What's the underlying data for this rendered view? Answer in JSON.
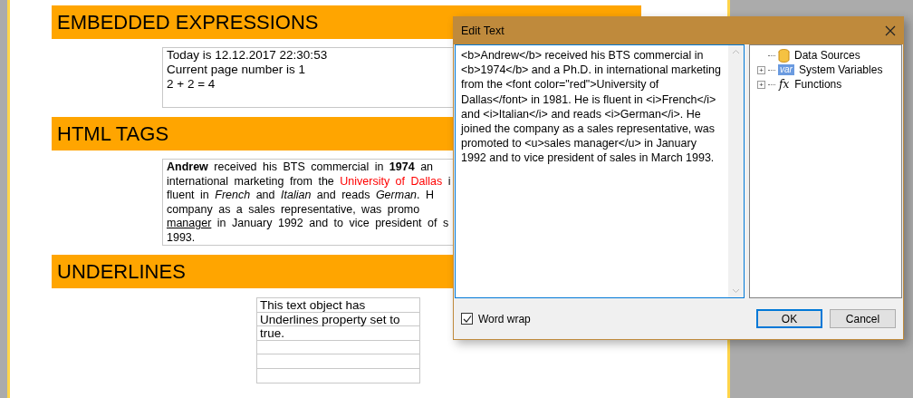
{
  "report": {
    "sections": [
      {
        "kind": "expressions",
        "title": "EMBEDDED EXPRESSIONS",
        "lines": [
          "Today is 12.12.2017 22:30:53",
          "Current page number is 1",
          "2 + 2 = 4"
        ]
      },
      {
        "kind": "html",
        "title": "HTML TAGS",
        "lines": [
          [
            {
              "text": "Andrew",
              "kind": "bold"
            },
            {
              "text": " received his BTS commercial in ",
              "kind": "plain"
            },
            {
              "text": "1974",
              "kind": "bold"
            },
            {
              "text": " an",
              "kind": "plain"
            }
          ],
          [
            {
              "text": "international marketing from the ",
              "kind": "plain"
            },
            {
              "text": "University of Dallas",
              "kind": "red"
            },
            {
              "text": " i",
              "kind": "plain"
            }
          ],
          [
            {
              "text": "fluent in ",
              "kind": "plain"
            },
            {
              "text": "French",
              "kind": "italic"
            },
            {
              "text": " and ",
              "kind": "plain"
            },
            {
              "text": "Italian",
              "kind": "italic"
            },
            {
              "text": " and reads ",
              "kind": "plain"
            },
            {
              "text": "German",
              "kind": "italic"
            },
            {
              "text": ". H",
              "kind": "plain"
            }
          ],
          [
            {
              "text": "company as a sales representative, was promo",
              "kind": "plain"
            }
          ],
          [
            {
              "text": "manager",
              "kind": "underline"
            },
            {
              "text": " in January 1992 and to vice president of s",
              "kind": "plain"
            }
          ],
          [
            {
              "text": "1993.",
              "kind": "plain"
            }
          ]
        ]
      },
      {
        "kind": "underlines",
        "title": "UNDERLINES",
        "lines": [
          "This text object has",
          "Underlines property set to",
          "true."
        ]
      }
    ]
  },
  "dialog": {
    "title": "Edit Text",
    "editor_text": "<b>Andrew</b> received his BTS commercial in <b>1974</b> and a Ph.D. in international marketing from the <font color=\"red\">University of Dallas</font> in 1981. He is fluent in <i>French</i> and <i>Italian</i> and reads <i>German</i>. He joined the company as a sales representative, was promoted to <u>sales manager</u> in January 1992 and to vice president of sales in March 1993.",
    "tree": [
      {
        "kind": "datasource",
        "label": "Data Sources",
        "expanded": true
      },
      {
        "kind": "variables",
        "label": "System Variables",
        "icon_text": "var",
        "expander": "+",
        "expanded": false
      },
      {
        "kind": "functions",
        "label": "Functions",
        "icon_text": "fx",
        "expander": "+",
        "expanded": false
      }
    ],
    "word_wrap": {
      "label": "Word wrap",
      "checked": true
    },
    "buttons": [
      {
        "label": "OK",
        "default": true
      },
      {
        "label": "Cancel",
        "default": false
      }
    ]
  }
}
